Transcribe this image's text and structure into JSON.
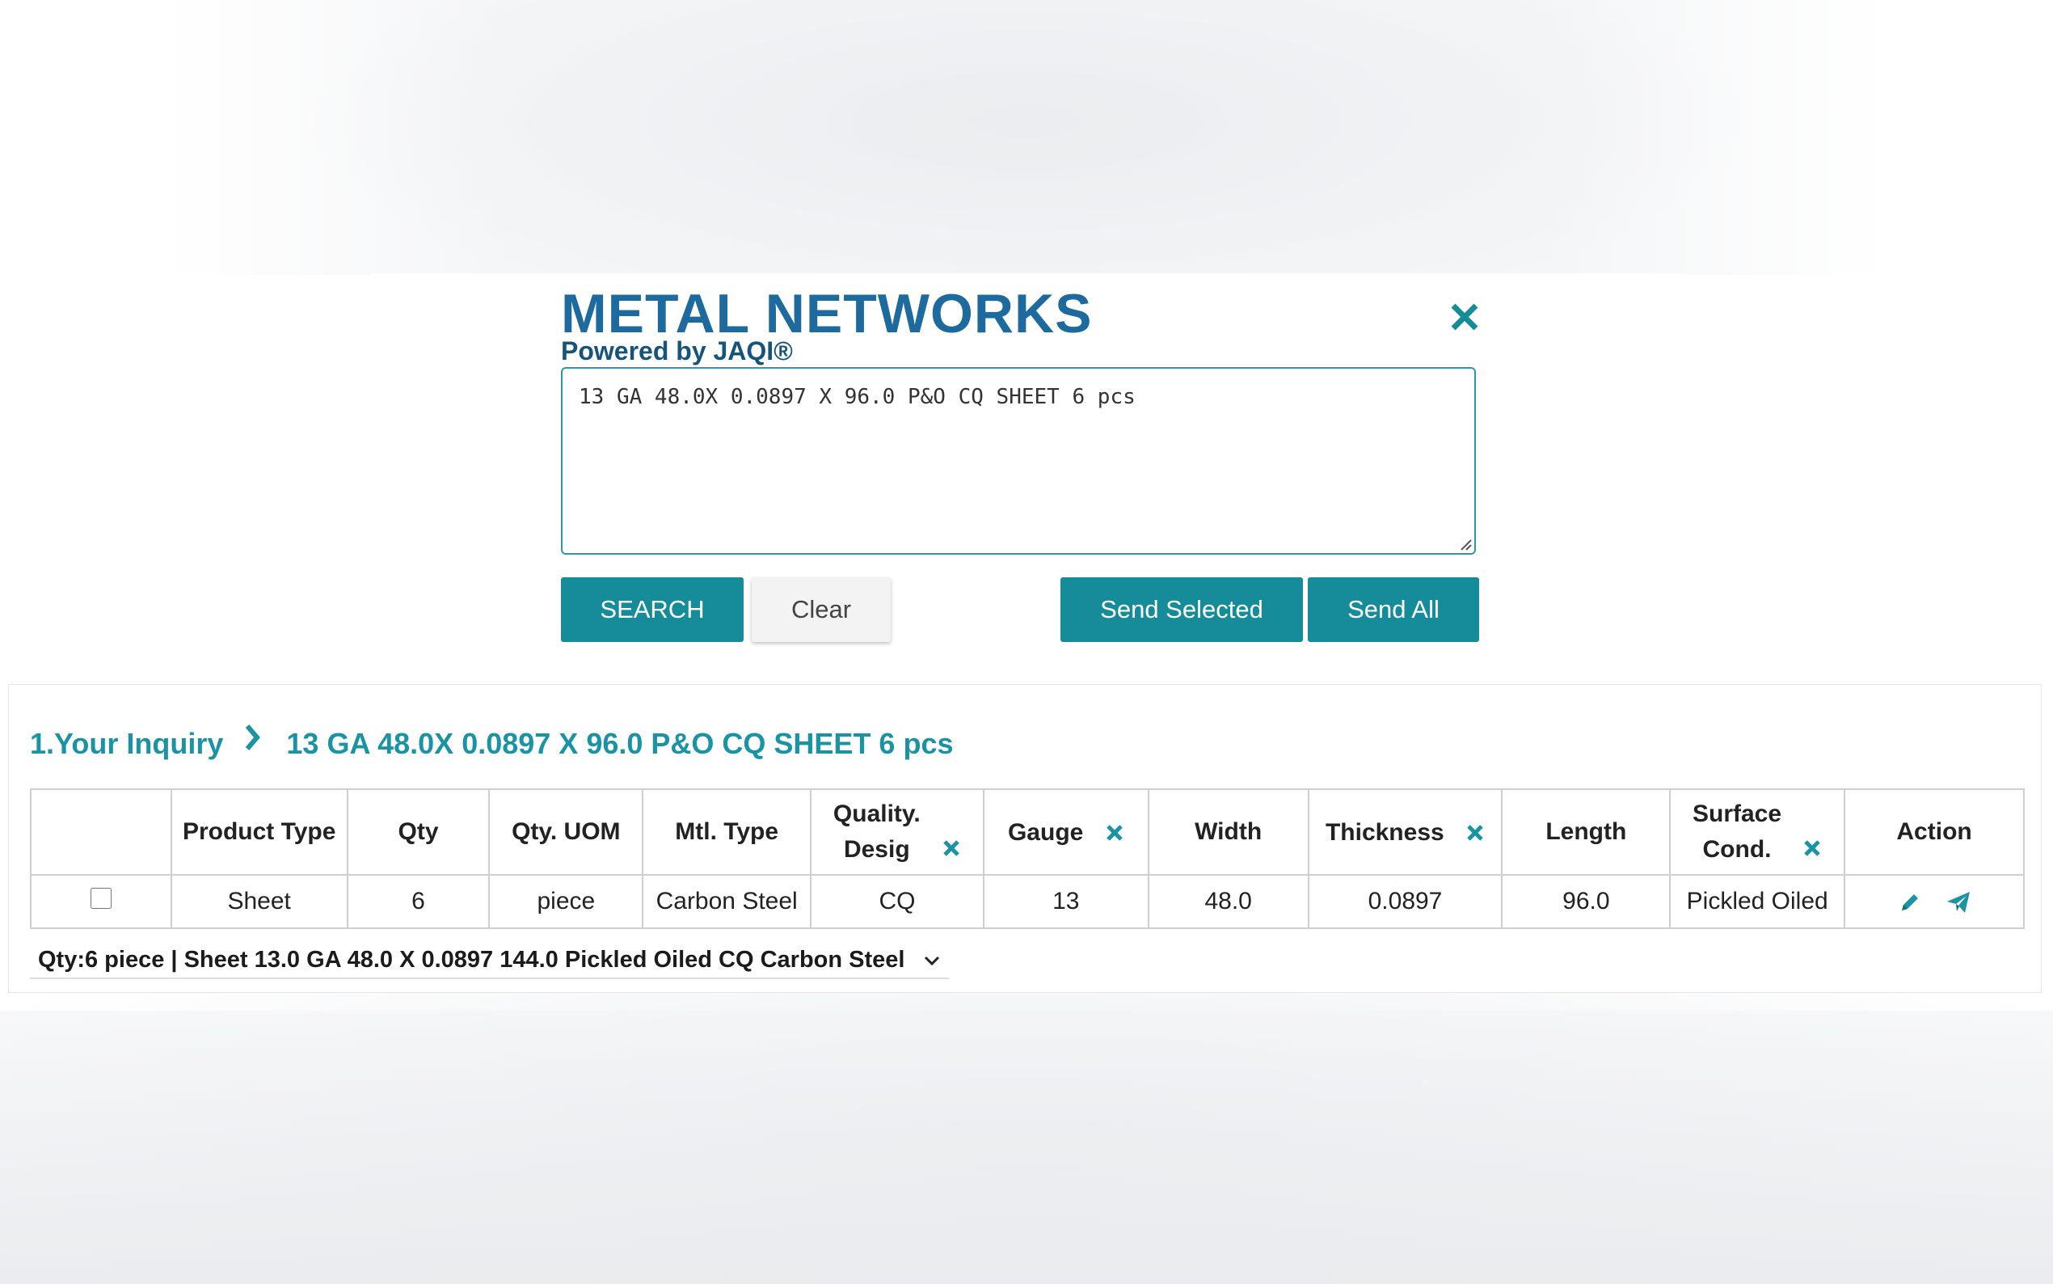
{
  "logo": {
    "title": "METAL NETWORKS",
    "subtitle": "Powered by JAQI®",
    "colors": {
      "primary": "#1d6a9e",
      "accent": "#1a93a4"
    }
  },
  "search": {
    "inquiry_text": "13 GA 48.0X 0.0897 X 96.0 P&O CQ SHEET 6 pcs",
    "buttons": {
      "search": "SEARCH",
      "clear": "Clear",
      "send_selected": "Send Selected",
      "send_all": "Send All"
    },
    "close_icon": "close-icon"
  },
  "result": {
    "breadcrumb_label": "1.Your Inquiry",
    "breadcrumb_query": "13 GA 48.0X 0.0897 X 96.0 P&O CQ SHEET 6 pcs",
    "columns": {
      "select": "",
      "product_type": "Product Type",
      "qty": "Qty",
      "qty_uom": "Qty. UOM",
      "mtl_type": "Mtl. Type",
      "quality_desig_1": "Quality.",
      "quality_desig_2": "Desig",
      "gauge": "Gauge",
      "width": "Width",
      "thickness": "Thickness",
      "length": "Length",
      "surface_cond_1": "Surface",
      "surface_cond_2": "Cond.",
      "action": "Action"
    },
    "rows": [
      {
        "selected": false,
        "product_type": "Sheet",
        "qty": "6",
        "qty_uom": "piece",
        "mtl_type": "Carbon Steel",
        "quality_desig": "CQ",
        "gauge": "13",
        "width": "48.0",
        "thickness": "0.0897",
        "length": "96.0",
        "surface_cond": "Pickled Oiled"
      }
    ],
    "summary": "Qty:6 piece | Sheet 13.0 GA 48.0 X 0.0897 144.0 Pickled Oiled CQ Carbon Steel",
    "colors": {
      "accent": "#1a93a4",
      "button": "#168c9b"
    }
  }
}
